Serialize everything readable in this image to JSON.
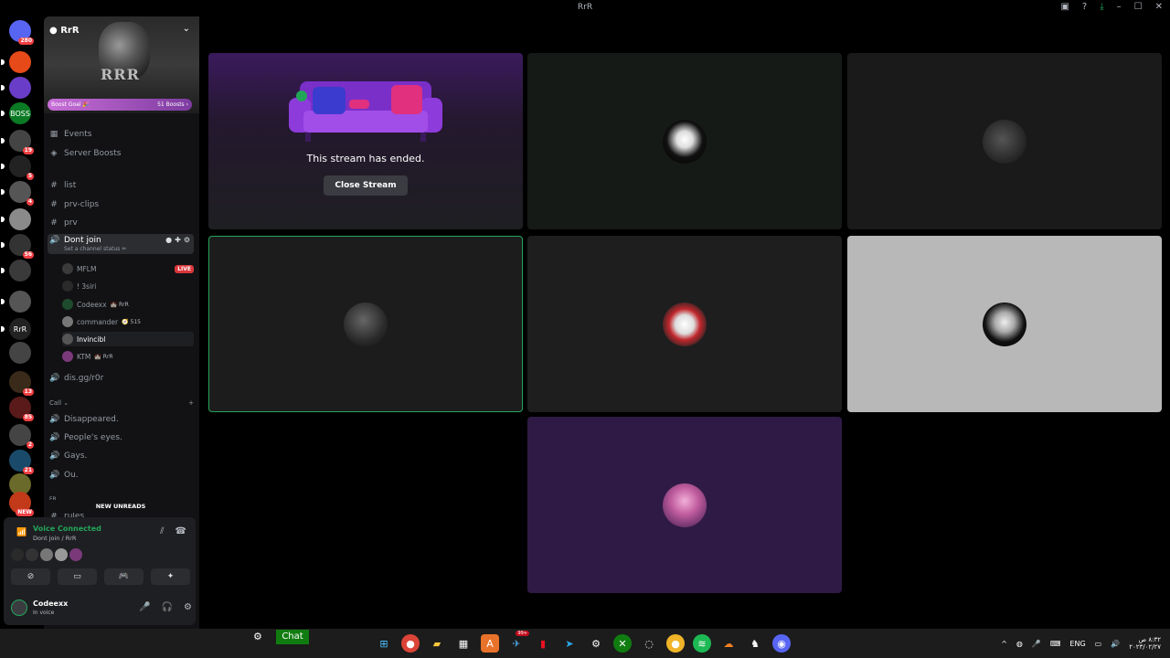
{
  "window": {
    "title": "RrR"
  },
  "guilds": [
    {
      "label": "",
      "badge": "280",
      "color": "#5865f2"
    },
    {
      "label": "",
      "badge": "",
      "color": "#e64a19"
    },
    {
      "label": "",
      "badge": "",
      "color": "#6a3dc8"
    },
    {
      "label": "BOSS",
      "badge": "",
      "color": "#0b7a24"
    },
    {
      "label": "",
      "badge": "19",
      "color": "#444"
    },
    {
      "label": "",
      "badge": "5",
      "color": "#222"
    },
    {
      "label": "",
      "badge": "4",
      "color": "#555"
    },
    {
      "label": "",
      "badge": "",
      "color": "#8a8a8a"
    },
    {
      "label": "",
      "badge": "56",
      "color": "#333"
    },
    {
      "label": "",
      "badge": "",
      "color": "#3a3a3a"
    },
    {
      "label": "",
      "badge": "",
      "color": "#555"
    },
    {
      "label": "RrR",
      "badge": "",
      "color": "#222"
    },
    {
      "label": "",
      "badge": "",
      "color": "#444"
    },
    {
      "label": "",
      "badge": "13",
      "color": "#3a2a1a"
    },
    {
      "label": "",
      "badge": "85",
      "color": "#5a1a1a"
    },
    {
      "label": "",
      "badge": "2",
      "color": "#444"
    },
    {
      "label": "",
      "badge": "21",
      "color": "#1a4a6a"
    },
    {
      "label": "",
      "badge": "",
      "color": "#6a6a2a"
    },
    {
      "label": "",
      "badge": "NEW",
      "color": "#c23a1a"
    }
  ],
  "server": {
    "name": "RrR",
    "banner_text": "RRR",
    "boost_goal": "Boost Goal 🎉",
    "boost_count": "51 Boosts ›"
  },
  "nav": {
    "events": "Events",
    "server_boosts": "Server Boosts"
  },
  "channels": {
    "list": "list",
    "prv_clips": "prv-clips",
    "prv": "prv",
    "voice_active": "Dont join",
    "voice_status": "Set a channel status ✏",
    "dis": "dis.gg/r0r"
  },
  "members": [
    {
      "name": "MFLM",
      "tag": "",
      "live": "LIVE"
    },
    {
      "name": "! 3siri",
      "tag": "",
      "live": ""
    },
    {
      "name": "Codeexx",
      "tag": "🏰 RrR",
      "live": ""
    },
    {
      "name": "commander",
      "tag": "🧭 515",
      "live": ""
    },
    {
      "name": "Invincibl",
      "tag": "",
      "live": ""
    },
    {
      "name": "KTM",
      "tag": "🏰 RrR",
      "live": ""
    }
  ],
  "call_category": "Call ⌄",
  "call_channels": [
    "Disappeared.",
    "People's eyes.",
    "Gays.",
    "Ou."
  ],
  "partial": {
    "cat": "FR",
    "rules": "rules"
  },
  "new_unreads": "NEW UNREADS",
  "voice": {
    "title": "Voice Connected",
    "sub": "Dont join / RrR"
  },
  "user": {
    "name": "Codeexx",
    "status": "In voice"
  },
  "stream": {
    "ended_text": "This stream has ended.",
    "close_label": "Close Stream"
  },
  "tiles": [
    {
      "bg": "#161a16",
      "accent": false
    },
    {
      "bg": "#1a1a1a",
      "accent": false
    },
    {
      "bg": "#1c1c1c",
      "accent": true
    },
    {
      "bg": "#1e1e1e",
      "accent": false
    },
    {
      "bg": "#b8b8b8",
      "accent": false
    },
    {
      "bg": "#2f1a45",
      "accent": false
    }
  ],
  "taskbar": {
    "chat": "Chat",
    "lang": "ENG",
    "time": "٨:٣٢ ص",
    "date": "٢٠٢٣/٠٢/٢٧",
    "tray_badge": "99+"
  }
}
